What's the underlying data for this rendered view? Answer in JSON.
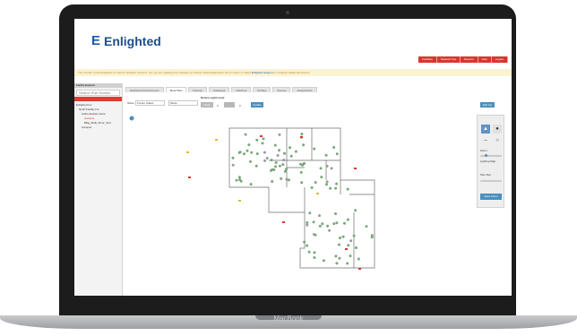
{
  "device": {
    "label": "MacBook"
  },
  "app": {
    "brand_mark": "E",
    "brand_name": "Enlighted",
    "topnav": [
      "Facilities",
      "Network Ops",
      "Reports",
      "Help",
      "Logout"
    ],
    "banner_text": "The number of the Enlighted 3.5 Server Software versions. For you are updating the software on fixtures. Rate Model More 4% or newer or select",
    "banner_link": "Enlighted Support",
    "banner_tail": "to configure additional fixtures."
  },
  "sidebar": {
    "title": "Facility Explorer",
    "search_placeholder": "Search Sub Section",
    "tree": [
      {
        "label": "Enlighted Inc",
        "selected": false
      },
      {
        "label": "North Facility Inc.",
        "selected": false
      },
      {
        "label": "Authentication Zone",
        "selected": false
      },
      {
        "label": "Campus",
        "selected": true
      },
      {
        "label": "Bldg_Multi_Floor_Test",
        "selected": false
      },
      {
        "label": "Campus",
        "selected": false
      }
    ]
  },
  "tabs": [
    "Dashboard Performance",
    "Floor Plan",
    "Fixtures",
    "Gateways",
    "Switches",
    "Profiles",
    "Scenes",
    "Assignments"
  ],
  "tabs_active": 1,
  "toolbar": {
    "show_label": "Show",
    "show_value": "Fixture Status",
    "mode_value": "Mode",
    "device_light_label": "Device Light Level",
    "device_light_value": "0",
    "button_apply": "Apply",
    "button_update": "Update",
    "button_right": "Edit Gw"
  },
  "right_panel": {
    "select_icon": "pointer-icon",
    "lock_icon": "lock-icon",
    "zoom_label": "Zoom",
    "level_label": "Lighting Map",
    "size_label": "Size Slot",
    "zoom_level": 0.25,
    "button_label": "Save Zoom"
  }
}
